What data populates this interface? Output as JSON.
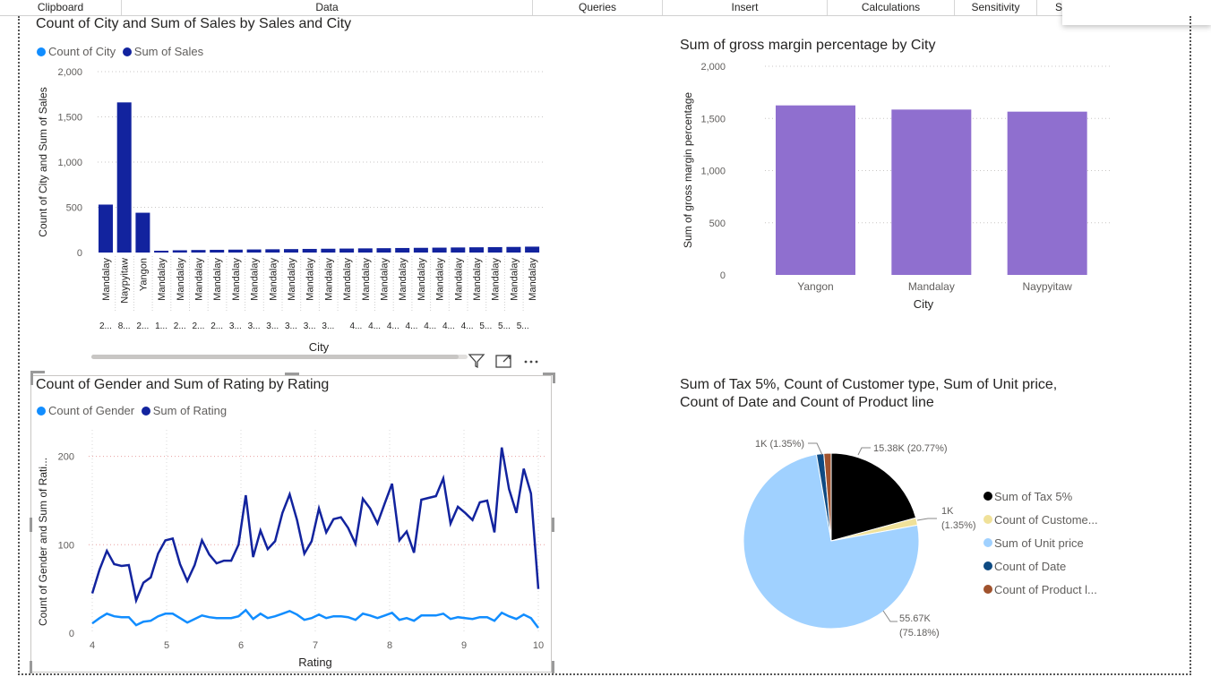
{
  "ribbon": {
    "tabs": [
      {
        "label": "Clipboard"
      },
      {
        "label": "Data"
      },
      {
        "label": "Queries"
      },
      {
        "label": "Insert"
      },
      {
        "label": "Calculations"
      },
      {
        "label": "Sensitivity"
      },
      {
        "label": "Sh"
      }
    ]
  },
  "colors": {
    "series_light": "#118dff",
    "series_dark": "#12239e",
    "bar_purple": "#8f6fcf",
    "pie_black": "#000000",
    "pie_yellow": "#f0e199",
    "pie_lightblue": "#a0d1ff",
    "pie_navy": "#0e4a82",
    "pie_brown": "#a0522d"
  },
  "chart_data": [
    {
      "id": "sales-city",
      "type": "bar",
      "title": "Count of City and Sum of Sales by Sales and City",
      "xlabel": "City",
      "ylabel": "Count of City and Sum of Sales",
      "ylim": [
        0,
        2000
      ],
      "yticks": [
        "0",
        "500",
        "1,000",
        "1,500",
        "2,000"
      ],
      "grid": true,
      "legend_position": "top-left",
      "legend": [
        {
          "label": "Count of City",
          "color": "#118dff"
        },
        {
          "label": "Sum of Sales",
          "color": "#12239e"
        }
      ],
      "categories": [
        "Mandalay",
        "Naypyitaw",
        "Yangon",
        "Mandalay",
        "Mandalay",
        "Mandalay",
        "Mandalay",
        "Mandalay",
        "Mandalay",
        "Mandalay",
        "Mandalay",
        "Mandalay",
        "Mandalay",
        "Mandalay",
        "Mandalay",
        "Mandalay",
        "Mandalay",
        "Mandalay",
        "Mandalay",
        "Mandalay",
        "Mandalay",
        "Mandalay",
        "Mandalay",
        "Mandalay"
      ],
      "sublabels": [
        "2...",
        "8...",
        "2...",
        "1...",
        "2...",
        "2...",
        "2...",
        "3...",
        "3...",
        "3...",
        "3...",
        "3...",
        "3...",
        "4...",
        "4...",
        "4...",
        "4...",
        "4...",
        "4...",
        "4...",
        "5...",
        "5...",
        "5..."
      ],
      "series": [
        {
          "name": "Sum of Sales",
          "values": [
            530,
            1660,
            440,
            20,
            25,
            28,
            30,
            32,
            34,
            36,
            38,
            40,
            42,
            44,
            46,
            48,
            50,
            52,
            54,
            56,
            58,
            60,
            62,
            65
          ]
        }
      ]
    },
    {
      "id": "gross-margin",
      "type": "bar",
      "title": "Sum of gross margin percentage by City",
      "xlabel": "City",
      "ylabel": "Sum of gross margin percentage",
      "ylim": [
        0,
        2000
      ],
      "yticks": [
        "0",
        "500",
        "1,000",
        "1,500",
        "2,000"
      ],
      "grid": true,
      "categories": [
        "Yangon",
        "Mandalay",
        "Naypyitaw"
      ],
      "series": [
        {
          "name": "Sum of gross margin percentage",
          "values": [
            1625,
            1585,
            1565
          ]
        }
      ]
    },
    {
      "id": "gender-rating",
      "type": "line",
      "title": "Count of Gender and Sum of Rating by Rating",
      "xlabel": "Rating",
      "ylabel": "Count of Gender and Sum of Rati...",
      "xlim": [
        4,
        10
      ],
      "ylim": [
        0,
        230
      ],
      "xticks": [
        "4",
        "5",
        "6",
        "7",
        "8",
        "9",
        "10"
      ],
      "yticks": [
        "0",
        "100",
        "200"
      ],
      "grid": true,
      "legend_position": "top-left",
      "legend": [
        {
          "label": "Count of Gender",
          "color": "#118dff"
        },
        {
          "label": "Sum of Rating",
          "color": "#12239e"
        }
      ],
      "x": [
        4.0,
        4.1,
        4.2,
        4.3,
        4.4,
        4.5,
        4.6,
        4.7,
        4.8,
        4.9,
        5.0,
        5.1,
        5.2,
        5.3,
        5.4,
        5.5,
        5.6,
        5.7,
        5.8,
        5.9,
        6.0,
        6.1,
        6.2,
        6.3,
        6.4,
        6.5,
        6.6,
        6.7,
        6.8,
        6.9,
        7.0,
        7.1,
        7.2,
        7.3,
        7.4,
        7.5,
        7.6,
        7.7,
        7.8,
        7.9,
        8.0,
        8.1,
        8.2,
        8.3,
        8.4,
        8.5,
        8.6,
        8.7,
        8.8,
        8.9,
        9.0,
        9.1,
        9.2,
        9.3,
        9.4,
        9.5,
        9.6,
        9.7,
        9.8,
        9.9,
        10.0
      ],
      "series": [
        {
          "name": "Sum of Rating",
          "values": [
            45,
            72,
            93,
            78,
            76,
            77,
            37,
            57,
            63,
            90,
            105,
            107,
            78,
            59,
            77,
            105,
            89,
            79,
            82,
            82,
            100,
            156,
            86,
            116,
            95,
            104,
            136,
            157,
            128,
            90,
            104,
            141,
            114,
            129,
            131,
            119,
            101,
            152,
            141,
            124,
            147,
            169,
            105,
            115,
            91,
            151,
            153,
            155,
            175,
            124,
            143,
            136,
            128,
            148,
            150,
            114,
            210,
            163,
            136,
            186,
            158,
            50
          ]
        },
        {
          "name": "Count of Gender",
          "values": [
            11,
            17,
            22,
            19,
            18,
            18,
            9,
            13,
            14,
            19,
            22,
            22,
            17,
            12,
            16,
            20,
            18,
            17,
            17,
            17,
            19,
            26,
            16,
            22,
            17,
            19,
            22,
            25,
            21,
            15,
            17,
            21,
            17,
            19,
            19,
            18,
            15,
            22,
            20,
            17,
            20,
            23,
            15,
            17,
            14,
            20,
            20,
            20,
            22,
            16,
            18,
            17,
            16,
            18,
            18,
            14,
            23,
            19,
            16,
            21,
            17,
            6
          ]
        }
      ]
    },
    {
      "id": "pie-summary",
      "type": "pie",
      "title": "Sum of Tax 5%, Count of Customer type, Sum of Unit price,",
      "title_line2": "Count of Date and Count of Product line",
      "legend_position": "right",
      "slices": [
        {
          "label": "Sum of Tax 5%",
          "value": 15.38,
          "data_label": "15.38K (20.77%)",
          "color": "#000000"
        },
        {
          "label": "Count of Custome...",
          "value": 1.0,
          "data_label": "1K (1.35%)",
          "color": "#f0e199"
        },
        {
          "label": "Sum of Unit price",
          "value": 55.67,
          "data_label": "55.67K (75.18%)",
          "color": "#a0d1ff"
        },
        {
          "label": "Count of Date",
          "value": 1.0,
          "data_label": "1K (1.35%)",
          "color": "#0e4a82"
        },
        {
          "label": "Count of Product l...",
          "value": 1.0,
          "data_label": "1K (1.35%)",
          "color": "#a0522d"
        }
      ],
      "label_1k_a": "1K",
      "label_1k_b": "(1.35%)",
      "label_55a": "55.67K",
      "label_55b": "(75.18%)"
    }
  ]
}
